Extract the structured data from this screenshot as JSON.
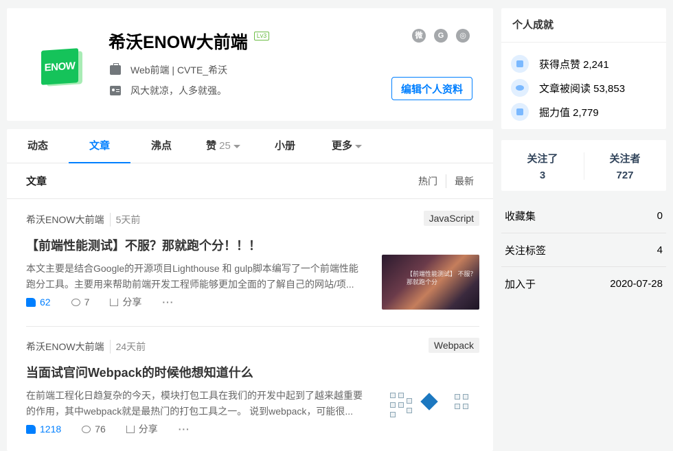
{
  "profile": {
    "avatar_text": "ENOW",
    "name": "希沃ENOW大前端",
    "level": "Lv3",
    "job": "Web前端 | CVTE_希沃",
    "bio": "风大就凉，人多就强。",
    "edit_label": "编辑个人资料",
    "socials": [
      "weibo-icon",
      "github-icon",
      "globe-icon"
    ]
  },
  "tabs": [
    {
      "label": "动态"
    },
    {
      "label": "文章",
      "active": true
    },
    {
      "label": "沸点"
    },
    {
      "label": "赞",
      "count": "25"
    },
    {
      "label": "小册"
    },
    {
      "label": "更多"
    }
  ],
  "list": {
    "title": "文章",
    "sort_hot": "热门",
    "sort_new": "最新"
  },
  "articles": [
    {
      "author": "希沃ENOW大前端",
      "date": "5天前",
      "tag": "JavaScript",
      "title": "【前端性能测试】不服？那就跑个分！！！",
      "abstract": "本文主要是结合Google的开源项目Lighthouse 和 gulp脚本编写了一个前端性能跑分工具。主要用来帮助前端开发工程师能够更加全面的了解自己的网站/项...",
      "likes": "62",
      "comments": "7",
      "share": "分享",
      "thumb_text": "【前端性能测试】 不服？那就跑个分"
    },
    {
      "author": "希沃ENOW大前端",
      "date": "24天前",
      "tag": "Webpack",
      "title": "当面试官问Webpack的时候他想知道什么",
      "abstract": "在前端工程化日趋复杂的今天，模块打包工具在我们的开发中起到了越来越重要的作用，其中webpack就是最热门的打包工具之一。 说到webpack，可能很...",
      "likes": "1218",
      "comments": "76",
      "share": "分享"
    }
  ],
  "achievements": {
    "title": "个人成就",
    "likes": "获得点赞 2,241",
    "reads": "文章被阅读 53,853",
    "power": "掘力值 2,779"
  },
  "follow": {
    "following_label": "关注了",
    "following": "3",
    "followers_label": "关注者",
    "followers": "727"
  },
  "stats": [
    {
      "label": "收藏集",
      "value": "0"
    },
    {
      "label": "关注标签",
      "value": "4"
    },
    {
      "label": "加入于",
      "value": "2020-07-28"
    }
  ],
  "colors": {
    "accent": "#007fff",
    "brand_green": "#15c35a"
  }
}
